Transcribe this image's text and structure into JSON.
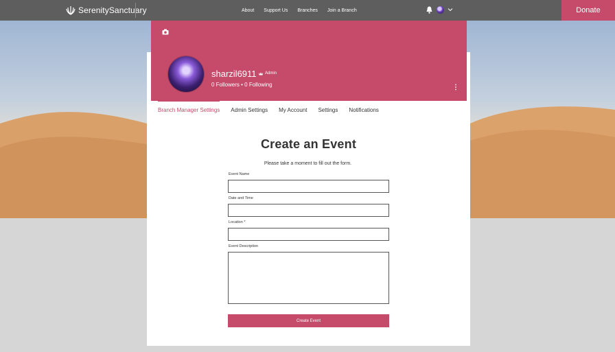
{
  "header": {
    "logo_text": "SerenitySanctuary",
    "nav": [
      "About",
      "Support Us",
      "Branches",
      "Join a Branch"
    ],
    "donate_label": "Donate"
  },
  "profile": {
    "username": "sharzil6911",
    "role_badge": "Admin",
    "follow_stats": "0 Followers • 0 Following"
  },
  "tabs": [
    "Branch Manager Settings",
    "Admin Settings",
    "My Account",
    "Settings",
    "Notifications"
  ],
  "form": {
    "title": "Create an Event",
    "subtitle": "Please take a moment to fill out the form.",
    "fields": [
      {
        "label": "Event Name",
        "value": ""
      },
      {
        "label": "Date and Time",
        "value": ""
      },
      {
        "label": "Location *",
        "value": ""
      },
      {
        "label": "Event Description",
        "value": ""
      }
    ],
    "submit_label": "Create Event"
  },
  "colors": {
    "accent": "#c64a6a",
    "topbar": "#5e5e5e"
  }
}
